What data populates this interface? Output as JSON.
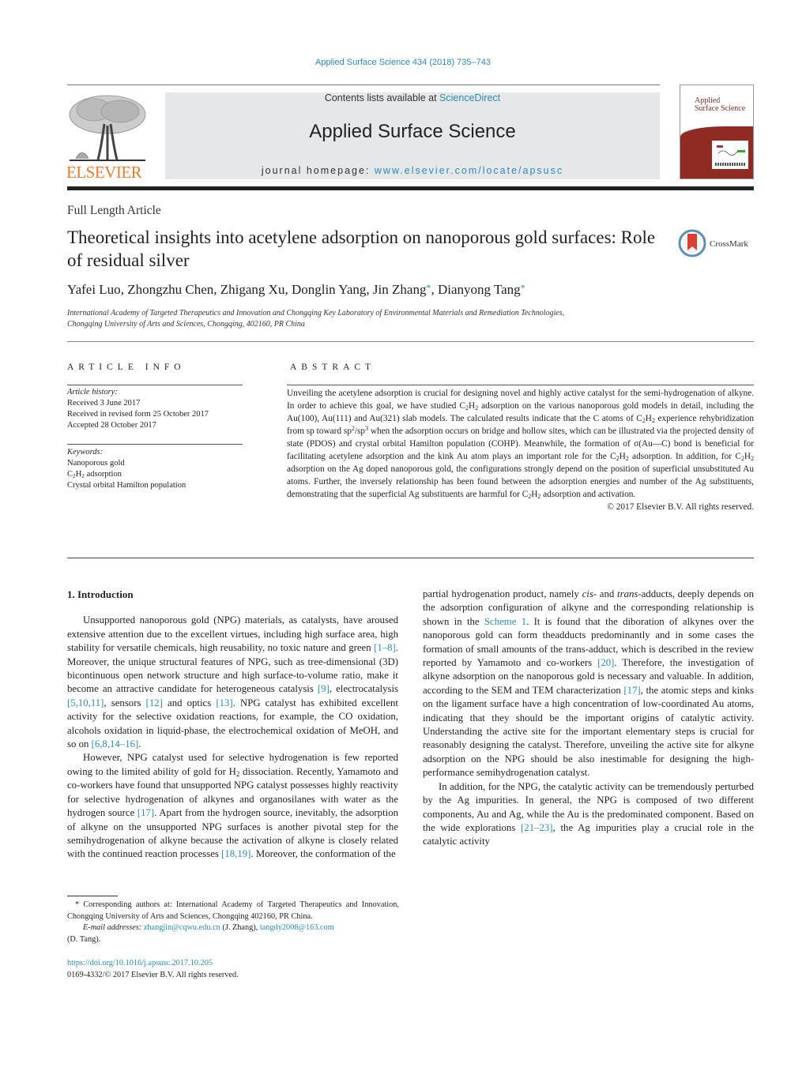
{
  "header": {
    "journal_reference": "Applied Surface Science 434 (2018) 735–743",
    "contents_prefix": "Contents lists available at ",
    "contents_link": "ScienceDirect",
    "journal_name": "Applied Surface Science",
    "homepage_prefix": "journal homepage: ",
    "homepage_link": "www.elsevier.com/locate/apsusc",
    "publisher_logo_text": "ELSEVIER",
    "cover_title_line1": "Applied",
    "cover_title_line2": "Surface Science",
    "crossmark_label": "CrossMark"
  },
  "colors": {
    "link": "#2a8bb8",
    "elsevier_orange": "#f07a2a",
    "masthead_gray": "#e6e7e8",
    "cover_red": "#8f2b23"
  },
  "article": {
    "type": "Full Length Article",
    "title": "Theoretical insights into acetylene adsorption on nanoporous gold surfaces: Role of residual silver",
    "authors": [
      {
        "name": "Yafei Luo",
        "corresponding": false
      },
      {
        "name": "Zhongzhu Chen",
        "corresponding": false
      },
      {
        "name": "Zhigang Xu",
        "corresponding": false
      },
      {
        "name": "Donglin Yang",
        "corresponding": false
      },
      {
        "name": "Jin Zhang",
        "corresponding": true
      },
      {
        "name": "Dianyong Tang",
        "corresponding": true
      }
    ],
    "author_separator": ", ",
    "corresponding_mark": "*",
    "affiliation_line1": "International Academy of Targeted Therapeutics and Innovation and Chongqing Key Laboratory of Environmental Materials and Remediation Technologies,",
    "affiliation_line2": "Chongqing University of Arts and Sciences, Chongqing, 402160, PR China"
  },
  "article_info": {
    "heading": "ARTICLE INFO",
    "history_label": "Article history:",
    "history": [
      "Received 3 June 2017",
      "Received in revised form 25 October 2017",
      "Accepted 28 October 2017"
    ],
    "keywords_label": "Keywords:",
    "keywords": [
      "Nanoporous gold",
      "C2H2 adsorption",
      "Crystal orbital Hamilton population"
    ]
  },
  "abstract": {
    "heading": "ABSTRACT",
    "text": "Unveiling the acetylene adsorption is crucial for designing novel and highly active catalyst for the semi-hydrogenation of alkyne. In order to achieve this goal, we have studied C2H2 adsorption on the various nanoporous gold models in detail, including the Au(100), Au(111) and Au(321) slab models. The calculated results indicate that the C atoms of C2H2 experience rehybridization from sp toward sp2/sp3 when the adsorption occurs on bridge and hollow sites, which can be illustrated via the projected density of state (PDOS) and crystal orbital Hamilton population (COHP). Meanwhile, the formation of σ(Au—C) bond is beneficial for facilitating acetylene adsorption and the kink Au atom plays an important role for the C2H2 adsorption. In addition, for C2H2 adsorption on the Ag doped nanoporous gold, the configurations strongly depend on the position of superficial unsubstituted Au atoms. Further, the inversely relationship has been found between the adsorption energies and number of the Ag substituents, demonstrating that the superficial Ag substituents are harmful for C2H2 adsorption and activation.",
    "copyright": "© 2017 Elsevier B.V. All rights reserved."
  },
  "body": {
    "section_heading": "1.  Introduction",
    "paragraphs": [
      [
        {
          "t": "Unsupported nanoporous gold (NPG) materials, as catalysts, have aroused extensive attention due to the excellent virtues, including high surface area, high stability for versatile chemicals, high reusability, no toxic nature and green "
        },
        {
          "c": "[1–8]"
        },
        {
          "t": ". Moreover, the unique structural features of NPG, such as tree-dimensional (3D) bicontinuous open network structure and high surface-to-volume ratio, make it become an attractive candidate for heterogeneous catalysis "
        },
        {
          "c": "[9]"
        },
        {
          "t": ", electrocatalysis "
        },
        {
          "c": "[5,10,11]"
        },
        {
          "t": ", sensors "
        },
        {
          "c": "[12]"
        },
        {
          "t": " and optics "
        },
        {
          "c": "[13]"
        },
        {
          "t": ". NPG catalyst has exhibited excellent activity for the selective oxidation reactions, for example, the CO oxidation, alcohols oxidation in liquid-phase, the electrochemical oxidation of MeOH, and so on "
        },
        {
          "c": "[6,8,14–16]"
        },
        {
          "t": "."
        }
      ],
      [
        {
          "t": "However, NPG catalyst used for selective hydrogenation is few reported owing to the limited ability of gold for H₂ dissociation. Recently, Yamamoto and co-workers have found that unsupported NPG catalyst possesses highly reactivity for selective hydrogenation of alkynes and organosilanes with water as the hydrogen source "
        },
        {
          "c": "[17]"
        },
        {
          "t": ". Apart from the hydrogen source, inevitably, the adsorption of alkyne on the unsupported NPG surfaces is another pivotal step for the semihydrogenation of alkyne because the activation of alkyne is closely related with the continued reaction processes "
        },
        {
          "c": "[18,19]"
        },
        {
          "t": ". Moreover, the conformation of the partial hydrogenation product, namely "
        },
        {
          "i": "cis"
        },
        {
          "t": "- and "
        },
        {
          "i": "trans"
        },
        {
          "t": "-adducts, deeply depends on the adsorption configuration of alkyne and the corresponding relationship is shown in the "
        },
        {
          "c": "Scheme 1"
        },
        {
          "t": ". It is found that the diboration of alkynes over the nanoporous gold can form theadducts predominantly and in some cases the formation of small amounts of the trans-adduct, which is described in the review reported by Yamamoto and co-workers "
        },
        {
          "c": "[20]"
        },
        {
          "t": ". Therefore, the investigation of alkyne adsorption on the nanoporous gold is necessary and valuable. In addition, according to the SEM and TEM characterization "
        },
        {
          "c": "[17]"
        },
        {
          "t": ", the atomic steps and kinks on the ligament surface have a high concentration of low-coordinated Au atoms, indicating that they should be the important origins of catalytic activity. Understanding the active site for the important elementary steps is crucial for reasonably designing the catalyst. Therefore, unveiling the active site for alkyne adsorption on the NPG should be also inestimable for designing the high-performance semihydrogenation catalyst."
        }
      ],
      [
        {
          "t": "In addition, for the NPG, the catalytic activity can be tremendously perturbed by the Ag impurities. In general, the NPG is composed of two different components, Au and Ag, while the Au is the predominated component. Based on the wide explorations "
        },
        {
          "c": "[21–23]"
        },
        {
          "t": ", the Ag impurities play a crucial role in the catalytic activity"
        }
      ]
    ]
  },
  "footnote": {
    "corresponding": "* Corresponding authors at: International Academy of Targeted Therapeutics and Innovation, Chongqing University of Arts and Sciences, Chongqing 402160, PR China.",
    "email_label": "E-mail addresses:",
    "email1": "zhangjin@cqwu.edu.cn",
    "email1_owner": " (J. Zhang), ",
    "email2": "tangdy2008@163.com",
    "email2_owner": "(D. Tang).",
    "doi": "https://doi.org/10.1016/j.apsusc.2017.10.205",
    "issn_copyright": "0169-4332/© 2017 Elsevier B.V. All rights reserved."
  }
}
